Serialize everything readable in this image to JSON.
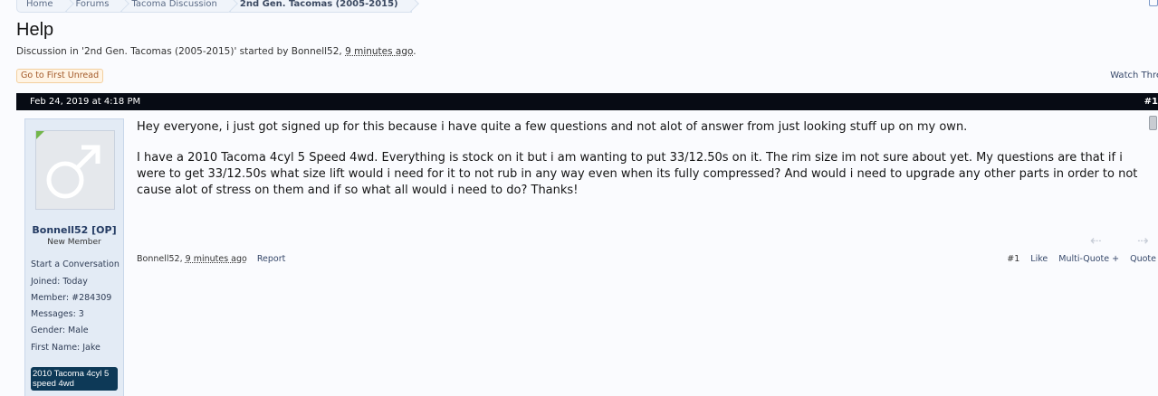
{
  "breadcrumb": [
    "Home",
    "Forums",
    "Tacoma Discussion",
    "2nd Gen. Tacomas (2005-2015)"
  ],
  "thread": {
    "title": "Help",
    "meta_prefix": "Discussion in '2nd Gen. Tacomas (2005-2015)' started by Bonnell52,",
    "meta_time": "9 minutes ago",
    "meta_end": "."
  },
  "actions": {
    "first_unread": "Go to First Unread",
    "watch": "Watch Thre"
  },
  "post": {
    "date": "Feb 24, 2019 at 4:18 PM",
    "number": "#1",
    "paragraphs": [
      "Hey everyone, i just got signed up for this because i have quite a few questions and not alot of answer from just looking stuff up on my own.",
      "I have a 2010 Tacoma 4cyl 5 Speed 4wd. Everything is stock on it but i am wanting to put 33/12.50s on it. The rim size im not sure about yet. My questions are that if i were to get 33/12.50s what size lift would i need for it to not rub in any way even when its fully compressed? And would i need to upgrade any other parts in order to not cause alot of stress on them and if so what all would i need to do? Thanks!"
    ],
    "author_footer": "Bonnell52,",
    "footer_time": "9 minutes ago",
    "report": "Report",
    "footer_number": "#1",
    "like": "Like",
    "multiquote": "Multi-Quote +",
    "quote": "Quote",
    "prev_arrow": "⇠",
    "next_arrow": "⇢"
  },
  "user": {
    "name": "Bonnell52 [OP]",
    "title": "New Member",
    "start_conversation": "Start a Conversation",
    "joined": "Joined: Today",
    "member": "Member: #284309",
    "messages": "Messages: 3",
    "gender": "Gender: Male",
    "first_name": "First Name: Jake",
    "vehicle_badge": "2010 Tacoma 4cyl 5 speed 4wd"
  },
  "colors": {
    "header_bar": "#070b14",
    "sidebar_bg": "#e3ebf5",
    "badge_bg": "#0d3957",
    "online_marker": "#72b64a"
  }
}
